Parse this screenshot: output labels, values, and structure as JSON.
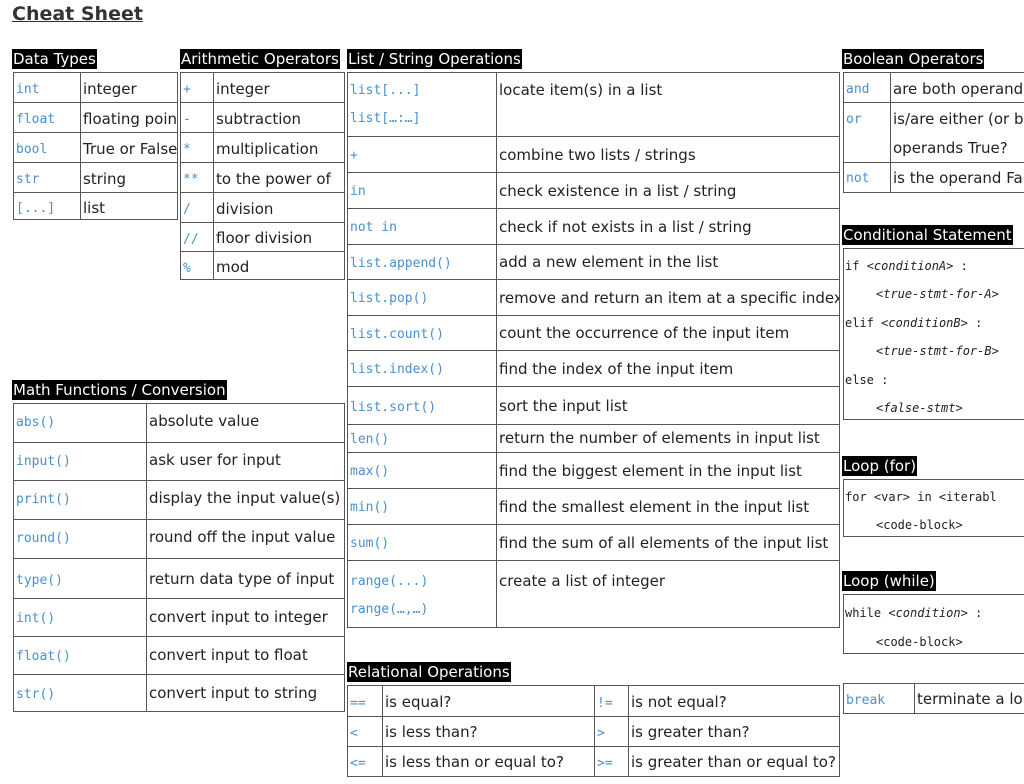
{
  "title": "Cheat Sheet",
  "data_types": {
    "header": "Data Types",
    "rows": [
      {
        "code": "int",
        "desc": "integer"
      },
      {
        "code": "float",
        "desc": "floating point"
      },
      {
        "code": "bool",
        "desc": "True or False"
      },
      {
        "code": "str",
        "desc": "string"
      },
      {
        "code": "[...]",
        "desc": "list"
      }
    ]
  },
  "arith": {
    "header": "Arithmetic Operators",
    "rows": [
      {
        "code": "+",
        "desc": "integer"
      },
      {
        "code": "-",
        "desc": "subtraction"
      },
      {
        "code": "*",
        "desc": "multiplication"
      },
      {
        "code": "**",
        "desc": "to the power of"
      },
      {
        "code": "/",
        "desc": "division"
      },
      {
        "code": "//",
        "desc": "floor division"
      },
      {
        "code": "%",
        "desc": "mod"
      }
    ]
  },
  "list_ops": {
    "header": "List / String Operations",
    "rows": [
      {
        "code": "list[...]",
        "code2": "list[…:…]",
        "desc": "locate item(s) in a list"
      },
      {
        "code": "+",
        "desc": "combine two lists / strings"
      },
      {
        "code": "in",
        "desc": "check existence in a list / string"
      },
      {
        "code": "not in",
        "desc": "check if not exists in a list / string"
      },
      {
        "code": "list.append()",
        "desc": "add a new element in the list"
      },
      {
        "code": "list.pop()",
        "desc": "remove and return an item at a specific index"
      },
      {
        "code": "list.count()",
        "desc": "count the occurrence of the input item"
      },
      {
        "code": "list.index()",
        "desc": "find the index of the input item"
      },
      {
        "code": "list.sort()",
        "desc": "sort the input list"
      },
      {
        "code": "len()",
        "desc": "return the number of elements in input list"
      },
      {
        "code": "max()",
        "desc": "find the biggest element in the input list"
      },
      {
        "code": "min()",
        "desc": "find the smallest element in the input list"
      },
      {
        "code": "sum()",
        "desc": "find the sum of all elements of the input list"
      },
      {
        "code": "range(...)",
        "code2": "range(…,…)",
        "desc": "create a list of integer"
      }
    ]
  },
  "math": {
    "header": "Math Functions / Conversion",
    "rows": [
      {
        "code": "abs()",
        "desc": "absolute value"
      },
      {
        "code": "input()",
        "desc": "ask user for input"
      },
      {
        "code": "print()",
        "desc": "display the input value(s)"
      },
      {
        "code": "round()",
        "desc": "round off the input value"
      },
      {
        "code": "type()",
        "desc": "return data type of input"
      },
      {
        "code": "int()",
        "desc": "convert input to integer"
      },
      {
        "code": "float()",
        "desc": "convert input to float"
      },
      {
        "code": "str()",
        "desc": "convert input to string"
      }
    ]
  },
  "relational": {
    "header": "Relational Operations",
    "rows": [
      {
        "c1": "==",
        "d1": "is equal?",
        "c2": "!=",
        "d2": "is not equal?"
      },
      {
        "c1": "<",
        "d1": "is less than?",
        "c2": ">",
        "d2": "is greater than?"
      },
      {
        "c1": "<=",
        "d1": "is less than or equal to?",
        "c2": ">=",
        "d2": "is greater than or equal to?"
      }
    ]
  },
  "boolean": {
    "header": "Boolean Operators",
    "rows": [
      {
        "code": "and",
        "desc": "are both operand"
      },
      {
        "code": "or",
        "desc": "is/are either (or b",
        "desc2": "operands True?"
      },
      {
        "code": "not",
        "desc": "is the operand Fa"
      }
    ]
  },
  "conditional": {
    "header": "Conditional Statement",
    "lines": [
      {
        "kw": "if",
        "arg": "<conditionA>",
        "tail": ":"
      },
      {
        "arg": "<true-stmt-for-A>"
      },
      {
        "kw": "elif",
        "arg": "<conditionB>",
        "tail": ":"
      },
      {
        "arg": "<true-stmt-for-B>"
      },
      {
        "kw": "else",
        "tail": ":"
      },
      {
        "arg": "<false-stmt>"
      }
    ]
  },
  "loop_for": {
    "header": "Loop (for)",
    "line1": "for <var> in <iterabl",
    "line2": "<code-block>"
  },
  "loop_while": {
    "header": "Loop (while)",
    "line1_kw": "while",
    "line1_arg": "<condition>",
    "line1_tail": ":",
    "line2": "<code-block>"
  },
  "break_row": {
    "code": "break",
    "desc": "terminate a lo"
  }
}
